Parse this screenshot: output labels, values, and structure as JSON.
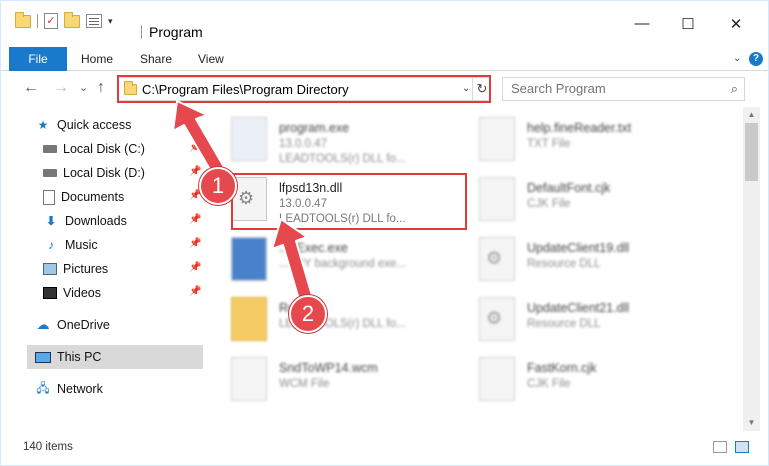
{
  "window": {
    "title": "Program",
    "controls": {
      "minimize": "—",
      "maximize": "☐",
      "close": "✕"
    }
  },
  "ribbon": {
    "tabs": [
      "File",
      "Home",
      "Share",
      "View"
    ],
    "help": "?"
  },
  "nav": {
    "back": "←",
    "forward": "→",
    "recent": "⌄",
    "up": "↑",
    "address": "C:\\Program Files\\Program Directory",
    "refresh": "↻",
    "search_placeholder": "Search Program",
    "search_icon": "⌕"
  },
  "sidebar": {
    "quick_access": "Quick access",
    "items": [
      {
        "label": "Local Disk (C:)",
        "icon": "disk-icon"
      },
      {
        "label": "Local Disk (D:)",
        "icon": "disk-icon"
      },
      {
        "label": "Documents",
        "icon": "documents-icon"
      },
      {
        "label": "Downloads",
        "icon": "downloads-icon"
      },
      {
        "label": "Music",
        "icon": "music-icon"
      },
      {
        "label": "Pictures",
        "icon": "pictures-icon"
      },
      {
        "label": "Videos",
        "icon": "videos-icon"
      }
    ],
    "onedrive": "OneDrive",
    "this_pc": "This PC",
    "network": "Network"
  },
  "files": {
    "left": [
      {
        "name": "program.exe",
        "line1": "13.0.0.47",
        "line2": "LEADTOOLS(r) DLL fo..."
      },
      {
        "name": "lfpsd13n.dll",
        "line1": "13.0.0.47",
        "line2": "LEADTOOLS(r) DLL fo..."
      },
      {
        "name": "...eExec.exe",
        "line1": "...BBY background exe...",
        "line2": ""
      },
      {
        "name": "Re...ce",
        "line1": "LEADTOOLS(r) DLL fo...",
        "line2": ""
      },
      {
        "name": "SndToWP14.wcm",
        "line1": "WCM File",
        "line2": ""
      }
    ],
    "right": [
      {
        "name": "help.fineReader.txt",
        "line1": "TXT File"
      },
      {
        "name": "DefaultFont.cjk",
        "line1": "CJK File"
      },
      {
        "name": "UpdateClient19.dll",
        "line1": "Resource DLL"
      },
      {
        "name": "UpdateClient21.dll",
        "line1": "Resource DLL"
      },
      {
        "name": "FastKorn.cjk",
        "line1": "CJK File"
      }
    ]
  },
  "status": {
    "count": "140 items"
  },
  "callouts": {
    "one": "1",
    "two": "2"
  },
  "colors": {
    "accent": "#1979ca",
    "highlight": "#e03a3a",
    "callout": "#e5484d"
  }
}
